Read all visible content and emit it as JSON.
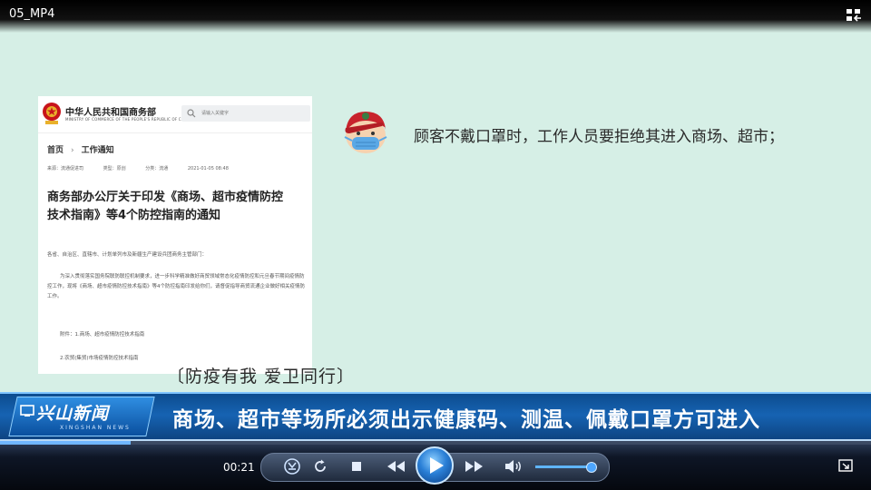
{
  "player": {
    "file_title": "05_MP4",
    "current_time": "00:21",
    "progress_fraction": 0.15,
    "volume_fraction": 0.95,
    "accent_color": "#4da6ff"
  },
  "doc": {
    "ministry_name": "中华人民共和国商务部",
    "ministry_en": "MINISTRY OF COMMERCE OF THE PEOPLE'S REPUBLIC OF CHINA",
    "search_placeholder": "请输入关键字",
    "breadcrumb_home": "首页",
    "breadcrumb_sep": "›",
    "breadcrumb_section": "工作通知",
    "meta_source": "来源：流通促进司",
    "meta_type": "类型：原创",
    "meta_category": "分类：流通",
    "meta_date": "2021-01-05 08:48",
    "title": "商务部办公厅关于印发《商场、超市疫情防控技术指南》等4个防控指南的通知",
    "para1": "各省、自治区、直辖市、计划单列市及新疆生产建设兵团商务主管部门：",
    "para2": "为深入贯彻落实国务院联防联控机制要求，进一步科学精准做好商贸领域常态化疫情防控和元旦春节期间疫情防控工作，现将《商场、超市疫情防控技术指南》等4个防控指南印发给你们，请督促指导商贸流通企业做好相关疫情防工作。",
    "para3": "附件：1.商场、超市疫情防控技术指南",
    "para4": "2.农贸(集贸)市场疫情防控技术指南"
  },
  "caption": "顾客不戴口罩时，工作人员要拒绝其进入商场、超市；",
  "slogan": "〔防疫有我 爱卫同行〕",
  "banner": {
    "logo_text": "兴山新闻",
    "logo_en": "XINGSHAN NEWS",
    "headline": "商场、超市等场所必须出示健康码、测温、佩戴口罩方可进入"
  },
  "icons": {
    "compact_mode": "compact-mode-icon",
    "clock": "clock-icon",
    "repeat": "repeat-icon",
    "stop": "stop-icon",
    "rewind": "rewind-icon",
    "play": "play-icon",
    "forward": "fast-forward-icon",
    "volume": "volume-icon",
    "fullscreen": "fullscreen-icon"
  }
}
